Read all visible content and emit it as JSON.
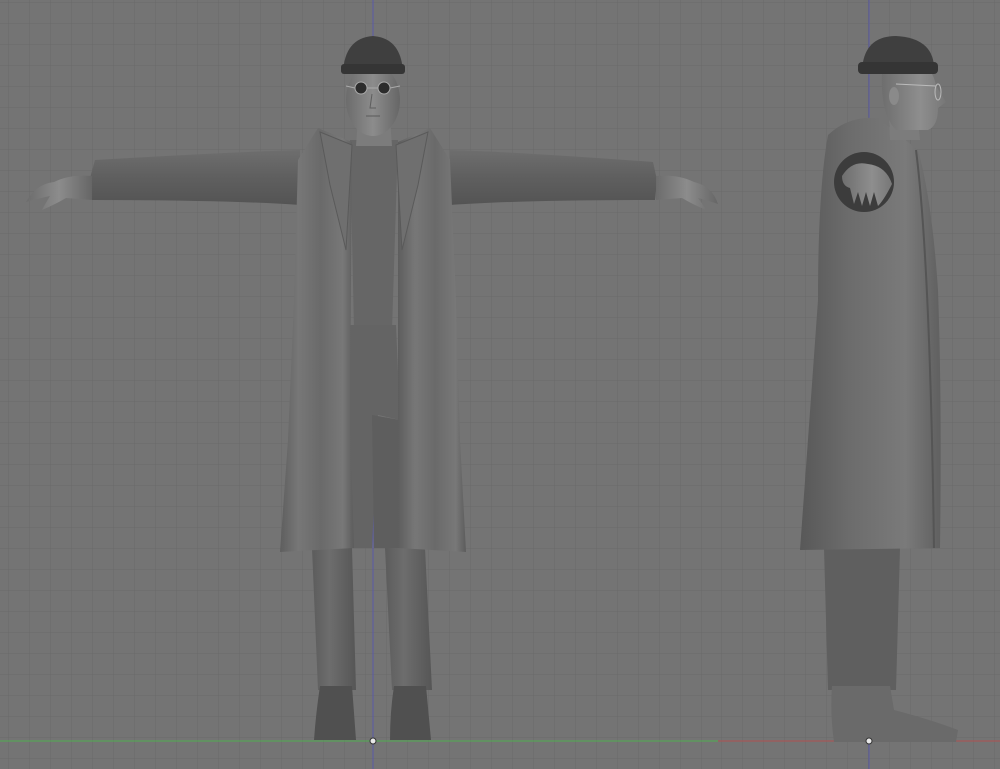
{
  "app": {
    "kind": "3d-modeling-viewport",
    "background_color": "#747474",
    "grid_color": "#6a6a6a",
    "axis_colors": {
      "vertical_axis": "#5a5aa8",
      "front_ground_axis": "#4fae4f",
      "side_ground_axis": "#b05050"
    }
  },
  "viewports": [
    {
      "id": "front",
      "view": "front",
      "subject": "character-model"
    },
    {
      "id": "side",
      "view": "side",
      "subject": "character-model"
    }
  ],
  "model": {
    "pose": "t-pose",
    "material_color": "#8a8a8a",
    "items": [
      "beanie",
      "round-sunglasses",
      "long-coat",
      "shirt",
      "trousers",
      "shoes"
    ]
  }
}
